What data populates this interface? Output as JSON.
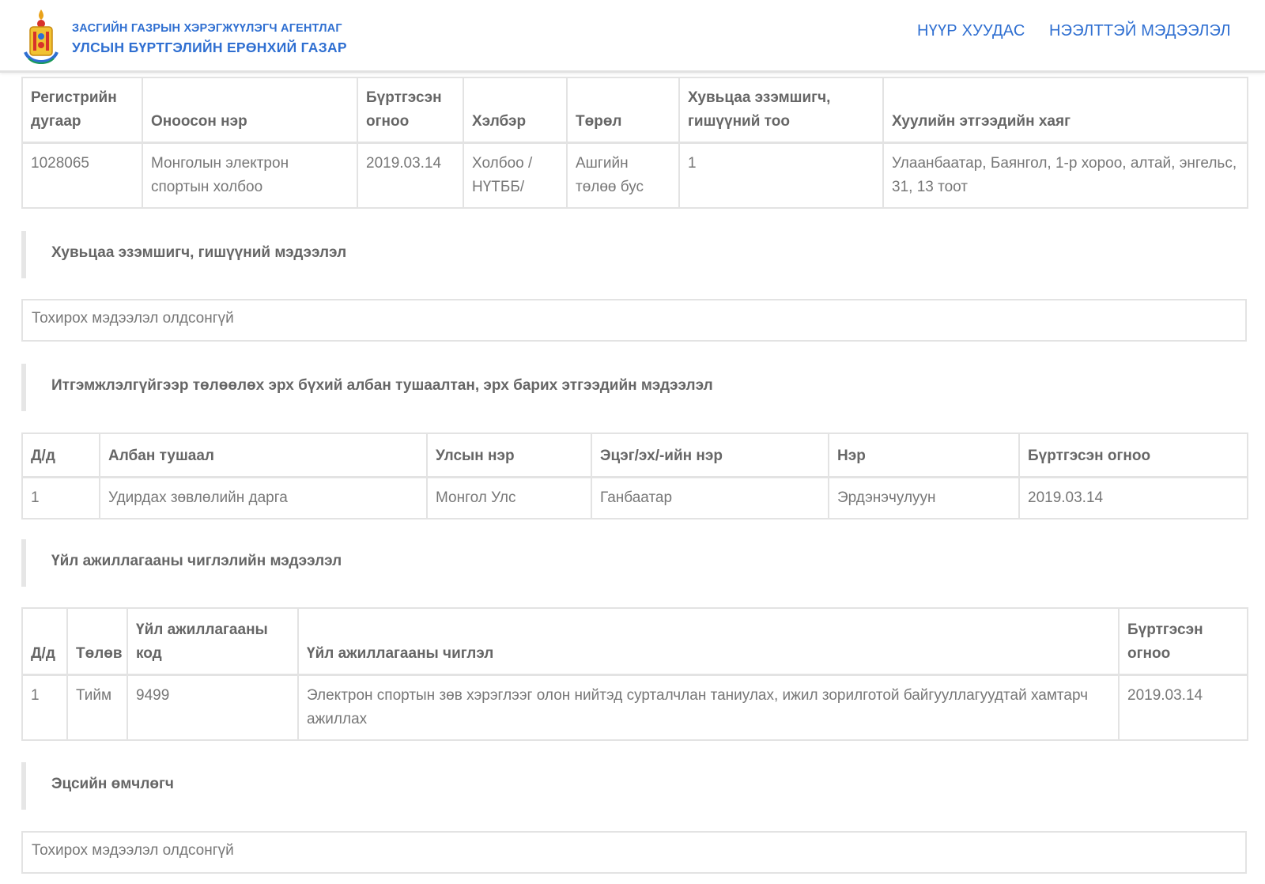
{
  "header": {
    "agency_line1": "ЗАСГИЙН ГАЗРЫН ХЭРЭГЖҮҮЛЭГЧ АГЕНТЛАГ",
    "agency_line2": "УЛСЫН БҮРТГЭЛИЙН ЕРӨНХИЙ ГАЗАР",
    "nav_home": "НҮҮР ХУУДАС",
    "nav_info": "НЭЭЛТТЭЙ МЭДЭЭЛЭЛ",
    "emblem_icon": "soyombo-emblem-icon"
  },
  "entity": {
    "headers": [
      "Регистрийн дугаар",
      "Оноосон нэр",
      "Бүртгэсэн огноо",
      "Хэлбэр",
      "Төрөл",
      "Хувьцаа эзэмшигч, гишүүний тоо",
      "Хуулийн этгээдийн хаяг"
    ],
    "row": [
      "1028065",
      "Монголын электрон спортын холбоо",
      "2019.03.14",
      "Холбоо / НҮТББ/",
      "Ашгийн төлөө бус",
      "1",
      "Улаанбаатар, Баянгол, 1-р хороо, алтай, энгельс, 31, 13 тоот"
    ]
  },
  "shareholders": {
    "title": "Хувьцаа эзэмшигч, гишүүний мэдээлэл",
    "empty": "Тохирох мэдээлэл олдсонгүй"
  },
  "officials": {
    "title": "Итгэмжлэлгүйгээр төлөөлөх эрх бүхий албан тушаалтан, эрх барих этгээдийн мэдээлэл",
    "headers": [
      "Д/д",
      "Албан тушаал",
      "Улсын нэр",
      "Эцэг/эх/-ийн нэр",
      "Нэр",
      "Бүртгэсэн огноо"
    ],
    "rows": [
      [
        "1",
        "Удирдах зөвлөлийн дарга",
        "Монгол Улс",
        "Ганбаатар",
        "Эрдэнэчулуун",
        "2019.03.14"
      ]
    ]
  },
  "activities": {
    "title": "Үйл ажиллагааны чиглэлийн мэдээлэл",
    "headers": [
      "Д/д",
      "Төлөв",
      "Үйл ажиллагааны код",
      "Үйл ажиллагааны чиглэл",
      "Бүртгэсэн огноо"
    ],
    "rows": [
      [
        "1",
        "Тийм",
        "9499",
        "Электрон спортын зөв хэрэглээг олон нийтэд сурталчлан таниулах, ижил зорилготой байгууллагуудтай хамтарч ажиллах",
        "2019.03.14"
      ]
    ]
  },
  "beneficial_owner": {
    "title": "Эцсийн өмчлөгч",
    "empty": "Тохирох мэдээлэл олдсонгүй"
  },
  "colors": {
    "brand_blue": "#2f6fd1",
    "border": "#e3e3e3",
    "text": "#777777"
  }
}
